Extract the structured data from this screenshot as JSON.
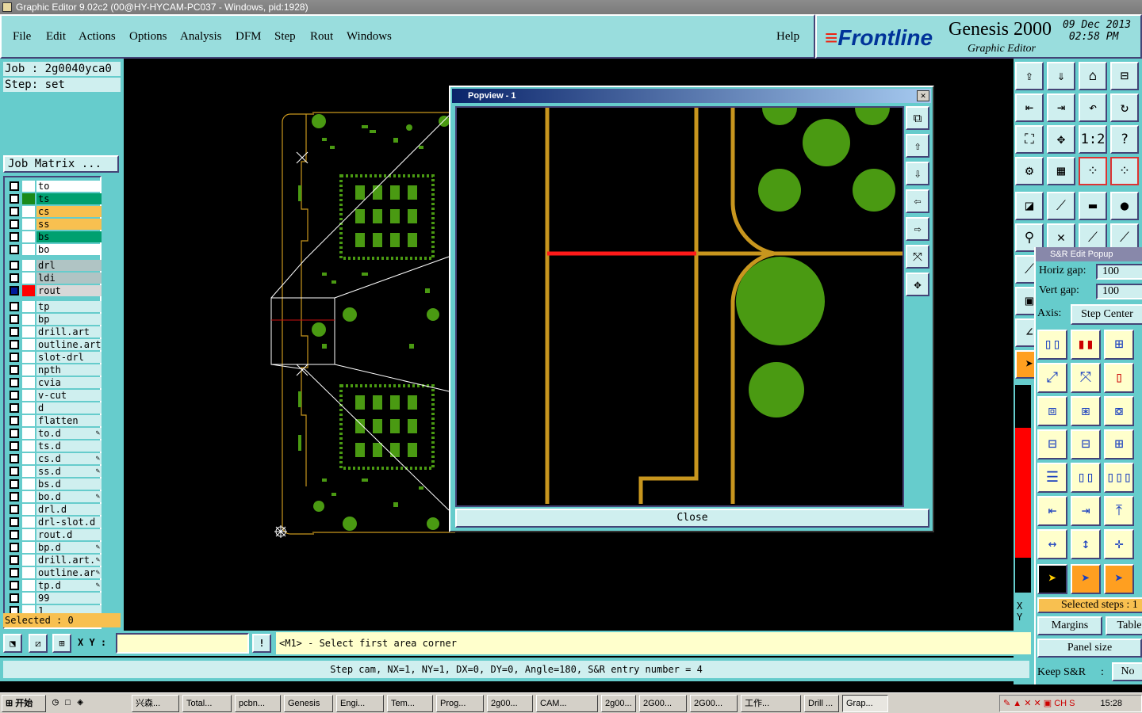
{
  "window": {
    "title": "Graphic Editor 9.02c2 (00@HY-HYCAM-PC037 - Windows, pid:1928)"
  },
  "menu": [
    {
      "label": "File"
    },
    {
      "label": "Edit"
    },
    {
      "label": "Actions"
    },
    {
      "label": "Options"
    },
    {
      "label": "Analysis"
    },
    {
      "label": "DFM"
    },
    {
      "label": "Step"
    },
    {
      "label": "Rout"
    },
    {
      "label": "Windows"
    }
  ],
  "help_label": "Help",
  "brand": {
    "logo": "Frontline",
    "product": "Genesis 2000",
    "subtitle": "Graphic Editor",
    "date": "09 Dec 2013",
    "time": "02:58 PM"
  },
  "job": {
    "job_text": "Job : 2g0040yca0",
    "step_text": "Step: set",
    "matrix_button": "Job Matrix ..."
  },
  "layers": [
    {
      "name": "to",
      "color": "#ffffff",
      "swatch": "#ffffff"
    },
    {
      "name": "ts",
      "color": "#00a070",
      "swatch": "#1a8a1a"
    },
    {
      "name": "cs",
      "color": "#f8c050",
      "swatch": "#ffffff"
    },
    {
      "name": "ss",
      "color": "#f8c050",
      "swatch": "#ffffff"
    },
    {
      "name": "bs",
      "color": "#00a070",
      "swatch": "#ffffff"
    },
    {
      "name": "bo",
      "color": "#ffffff",
      "swatch": "#ffffff"
    },
    {
      "name": "drl",
      "color": "#b0c4c4",
      "swatch": "#ffffff"
    },
    {
      "name": "ldi",
      "color": "#b0c4c4",
      "swatch": "#ffffff"
    },
    {
      "name": "rout",
      "color": "#d8d8d8",
      "swatch": "#ff0000",
      "active": true
    },
    {
      "name": "tp",
      "color": "#cfefef",
      "swatch": "#ffffff"
    },
    {
      "name": "bp",
      "color": "#cfefef",
      "swatch": "#ffffff"
    },
    {
      "name": "drill.art",
      "color": "#cfefef",
      "swatch": "#ffffff"
    },
    {
      "name": "outline.art",
      "color": "#cfefef",
      "swatch": "#ffffff"
    },
    {
      "name": "slot-drl",
      "color": "#cfefef",
      "swatch": "#ffffff"
    },
    {
      "name": "npth",
      "color": "#cfefef",
      "swatch": "#ffffff"
    },
    {
      "name": "cvia",
      "color": "#cfefef",
      "swatch": "#ffffff"
    },
    {
      "name": "v-cut",
      "color": "#cfefef",
      "swatch": "#ffffff"
    },
    {
      "name": "d",
      "color": "#cfefef",
      "swatch": "#ffffff"
    },
    {
      "name": "flatten",
      "color": "#cfefef",
      "swatch": "#ffffff"
    },
    {
      "name": "to.d",
      "color": "#cfefef",
      "swatch": "#ffffff",
      "mark": "✎"
    },
    {
      "name": "ts.d",
      "color": "#cfefef",
      "swatch": "#ffffff"
    },
    {
      "name": "cs.d",
      "color": "#cfefef",
      "swatch": "#ffffff",
      "mark": "✎"
    },
    {
      "name": "ss.d",
      "color": "#cfefef",
      "swatch": "#ffffff",
      "mark": "✎"
    },
    {
      "name": "bs.d",
      "color": "#cfefef",
      "swatch": "#ffffff"
    },
    {
      "name": "bo.d",
      "color": "#cfefef",
      "swatch": "#ffffff",
      "mark": "✎"
    },
    {
      "name": "drl.d",
      "color": "#cfefef",
      "swatch": "#ffffff"
    },
    {
      "name": "drl-slot.d",
      "color": "#cfefef",
      "swatch": "#ffffff"
    },
    {
      "name": "rout.d",
      "color": "#cfefef",
      "swatch": "#ffffff"
    },
    {
      "name": "bp.d",
      "color": "#cfefef",
      "swatch": "#ffffff",
      "mark": "✎"
    },
    {
      "name": "drill.art.",
      "color": "#cfefef",
      "swatch": "#ffffff",
      "mark": "✎"
    },
    {
      "name": "outline.ar",
      "color": "#cfefef",
      "swatch": "#ffffff",
      "mark": "✎"
    },
    {
      "name": "tp.d",
      "color": "#cfefef",
      "swatch": "#ffffff",
      "mark": "✎"
    },
    {
      "name": "99",
      "color": "#cfefef",
      "swatch": "#ffffff"
    },
    {
      "name": "1",
      "color": "#cfefef",
      "swatch": "#ffffff"
    }
  ],
  "selected_text": "Selected : 0",
  "bottom": {
    "xy_label": "X Y :",
    "xy_value": "",
    "prompt": "<M1> - Select first area corner",
    "warn_icon": "!"
  },
  "status_text": "Step cam, NX=1, NY=1, DX=0, DY=0, Angle=180, S&R entry number = 4",
  "popview": {
    "title": "Popview - 1",
    "close_label": "Close",
    "close_x": "✕"
  },
  "sr_popup": {
    "title": "S&R Edit Popup",
    "horiz_label": "Horiz gap:",
    "horiz_value": "100",
    "vert_label": "Vert  gap:",
    "vert_value": "100",
    "axis_label": "Axis:",
    "axis_button": "Step Center",
    "selected_steps": "Selected steps : 1",
    "margins": "Margins",
    "table": "Table",
    "panel_size": "Panel size",
    "keep_label": "Keep S&R",
    "keep_colon": ":",
    "keep_value": "No"
  },
  "coord_labels": {
    "x": "X",
    "y": "Y"
  },
  "taskbar": {
    "start": "开始",
    "tasks": [
      "兴森...",
      "Total...",
      "pcbn...",
      "Genesis",
      "Engi...",
      "Tem...",
      "Prog...",
      "2g00...",
      "CAM...",
      "2g00...",
      "2G00...",
      "2G00...",
      "工作...",
      "Drill ...",
      "Grap..."
    ],
    "clock": "15:28",
    "tray_ch": "CH"
  },
  "colors": {
    "teal": "#66cccc",
    "light": "#cfefef",
    "trace": "#c8961e",
    "pad": "#4a9a12",
    "rout": "#ff1a1a"
  },
  "icons": [
    "app-icon",
    "box-icon",
    "zoom-icon",
    "grid-icon",
    "warning-icon",
    "close-icon"
  ]
}
